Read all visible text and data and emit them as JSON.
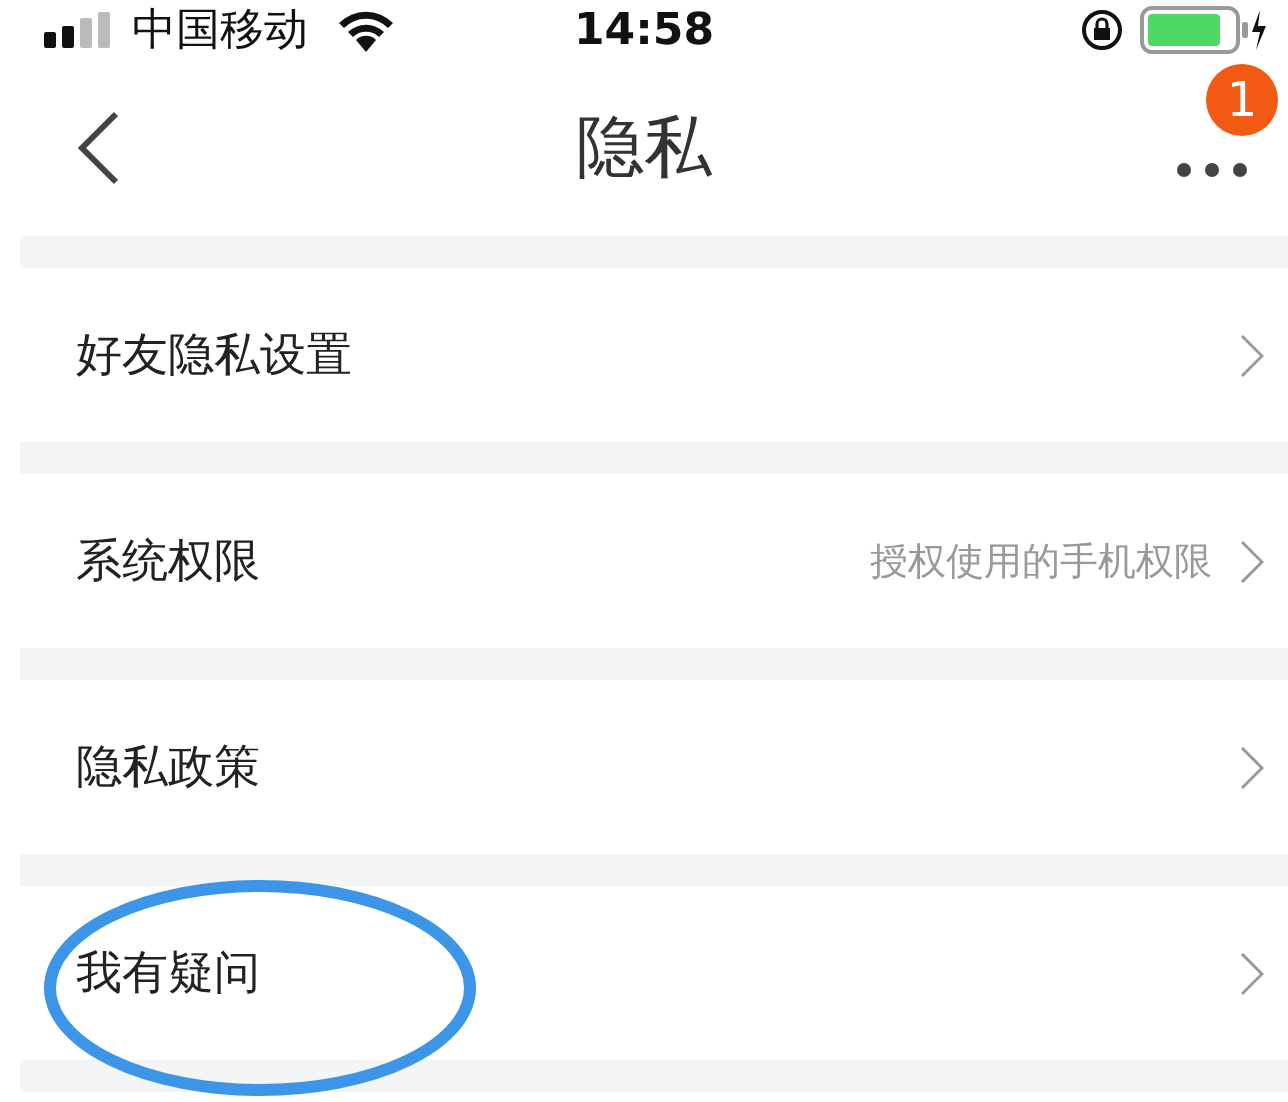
{
  "status_bar": {
    "carrier": "中国移动",
    "time": "14:58"
  },
  "nav": {
    "title": "隐私",
    "badge": "1"
  },
  "items": [
    {
      "label": "好友隐私设置",
      "circled": false
    },
    {
      "label": "系统权限",
      "hint": "授权使用的手机权限",
      "circled": false
    },
    {
      "label": "隐私政策",
      "circled": false
    },
    {
      "label": "我有疑问",
      "circled": true
    }
  ]
}
